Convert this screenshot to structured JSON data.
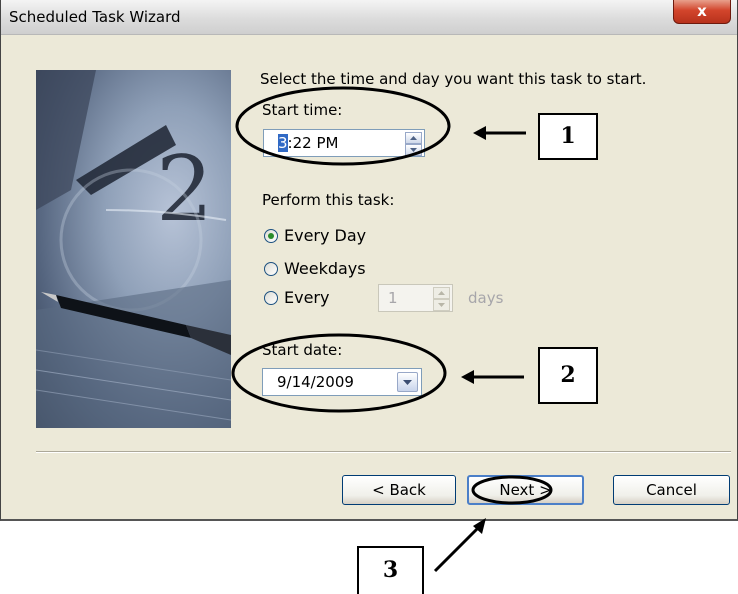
{
  "window": {
    "title": "Scheduled Task Wizard",
    "close_glyph": "x"
  },
  "instruction": "Select the time and day you want this task to start.",
  "start_time": {
    "label": "Start time:",
    "value_highlighted": "3",
    "value_rest": ":22 PM"
  },
  "perform": {
    "label": "Perform this task:",
    "options": [
      "Every Day",
      "Weekdays",
      "Every"
    ],
    "selected": "Every Day",
    "every_value": "1",
    "every_unit": "days"
  },
  "start_date": {
    "label": "Start date:",
    "value": "9/14/2009"
  },
  "buttons": {
    "back": "< Back",
    "next": "Next >",
    "cancel": "Cancel"
  },
  "annotations": {
    "callout_1": "1",
    "callout_2": "2",
    "callout_3": "3"
  },
  "colors": {
    "dialog_bg": "#ece9d8",
    "selection": "#316ac5",
    "close_button": "#d2452c"
  },
  "icons": [
    "close-icon",
    "spin-up-icon",
    "spin-down-icon",
    "dropdown-arrow-icon",
    "clock-pen-illustration"
  ]
}
